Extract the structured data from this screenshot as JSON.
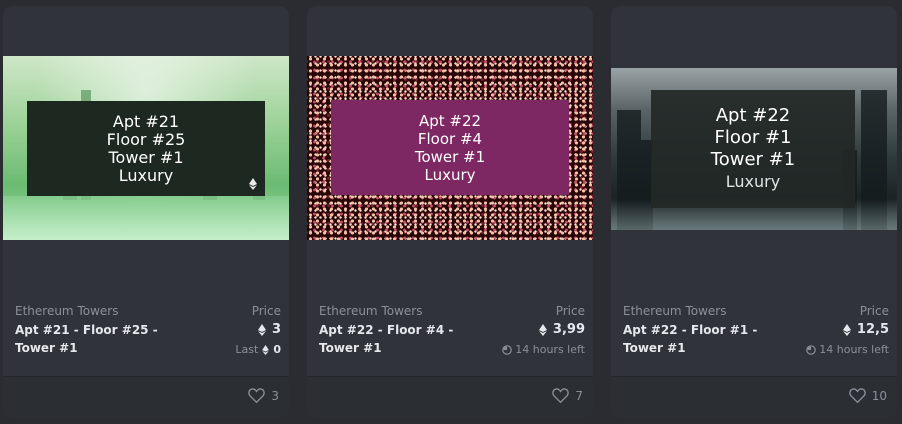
{
  "cards": [
    {
      "image": {
        "lines": [
          "Apt #21",
          "Floor #25",
          "Tower #1",
          "Luxury"
        ]
      },
      "collection": "Ethereum Towers",
      "name": "Apt #21 - Floor #25 - Tower #1",
      "price_label": "Price",
      "price": "3",
      "last_label": "Last",
      "last_price": "0",
      "likes": "3"
    },
    {
      "image": {
        "lines": [
          "Apt #22",
          "Floor #4",
          "Tower #1",
          "Luxury"
        ]
      },
      "collection": "Ethereum Towers",
      "name": "Apt #22 - Floor #4 - Tower #1",
      "price_label": "Price",
      "price": "3,99",
      "time_left": "14 hours left",
      "likes": "7"
    },
    {
      "image": {
        "lines": [
          "Apt #22",
          "Floor #1",
          "Tower #1",
          "Luxury"
        ]
      },
      "collection": "Ethereum Towers",
      "name": "Apt #22 - Floor #1 - Tower #1",
      "price_label": "Price",
      "price": "12,5",
      "time_left": "14 hours left",
      "likes": "10"
    }
  ],
  "colors": {
    "background": "#2a2c31",
    "card": "#303339",
    "text_primary": "#e5e8eb",
    "text_secondary": "#8a9099",
    "label_green": "#1c2820",
    "label_pink": "#7d2763"
  },
  "icons": {
    "currency": "ethereum-icon",
    "timer": "clock-icon",
    "like": "heart-icon"
  }
}
